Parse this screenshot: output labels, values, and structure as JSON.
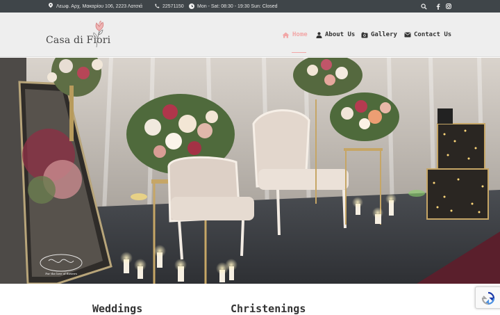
{
  "topbar": {
    "address": "Λεωφ. Αρχ. Μακαρίου 106, 2223 Λατσιά",
    "phone": "22571150",
    "hours": "Mon - Sat: 08:30 - 19:30 Sun: Closed",
    "icons": {
      "address": "map-pin-icon",
      "phone": "phone-icon",
      "hours": "clock-icon",
      "search": "search-icon",
      "facebook": "facebook-icon",
      "instagram": "instagram-icon"
    }
  },
  "brand": {
    "name": "Casa di Fiori",
    "logo_icon": "flower-icon"
  },
  "nav": {
    "items": [
      {
        "label": "Home",
        "icon": "home-icon",
        "active": true
      },
      {
        "label": "About Us",
        "icon": "user-icon",
        "active": false
      },
      {
        "label": "Gallery",
        "icon": "camera-icon",
        "active": false
      },
      {
        "label": "Contact Us",
        "icon": "envelope-icon",
        "active": false
      }
    ]
  },
  "hero": {
    "image_watermark": "For the love of flowers"
  },
  "sections": {
    "weddings": "Weddings",
    "christenings": "Christenings"
  },
  "colors": {
    "topbar": "#3f4549",
    "header": "#eeeeee",
    "accent": "#f2a7a7",
    "text": "#333333"
  }
}
